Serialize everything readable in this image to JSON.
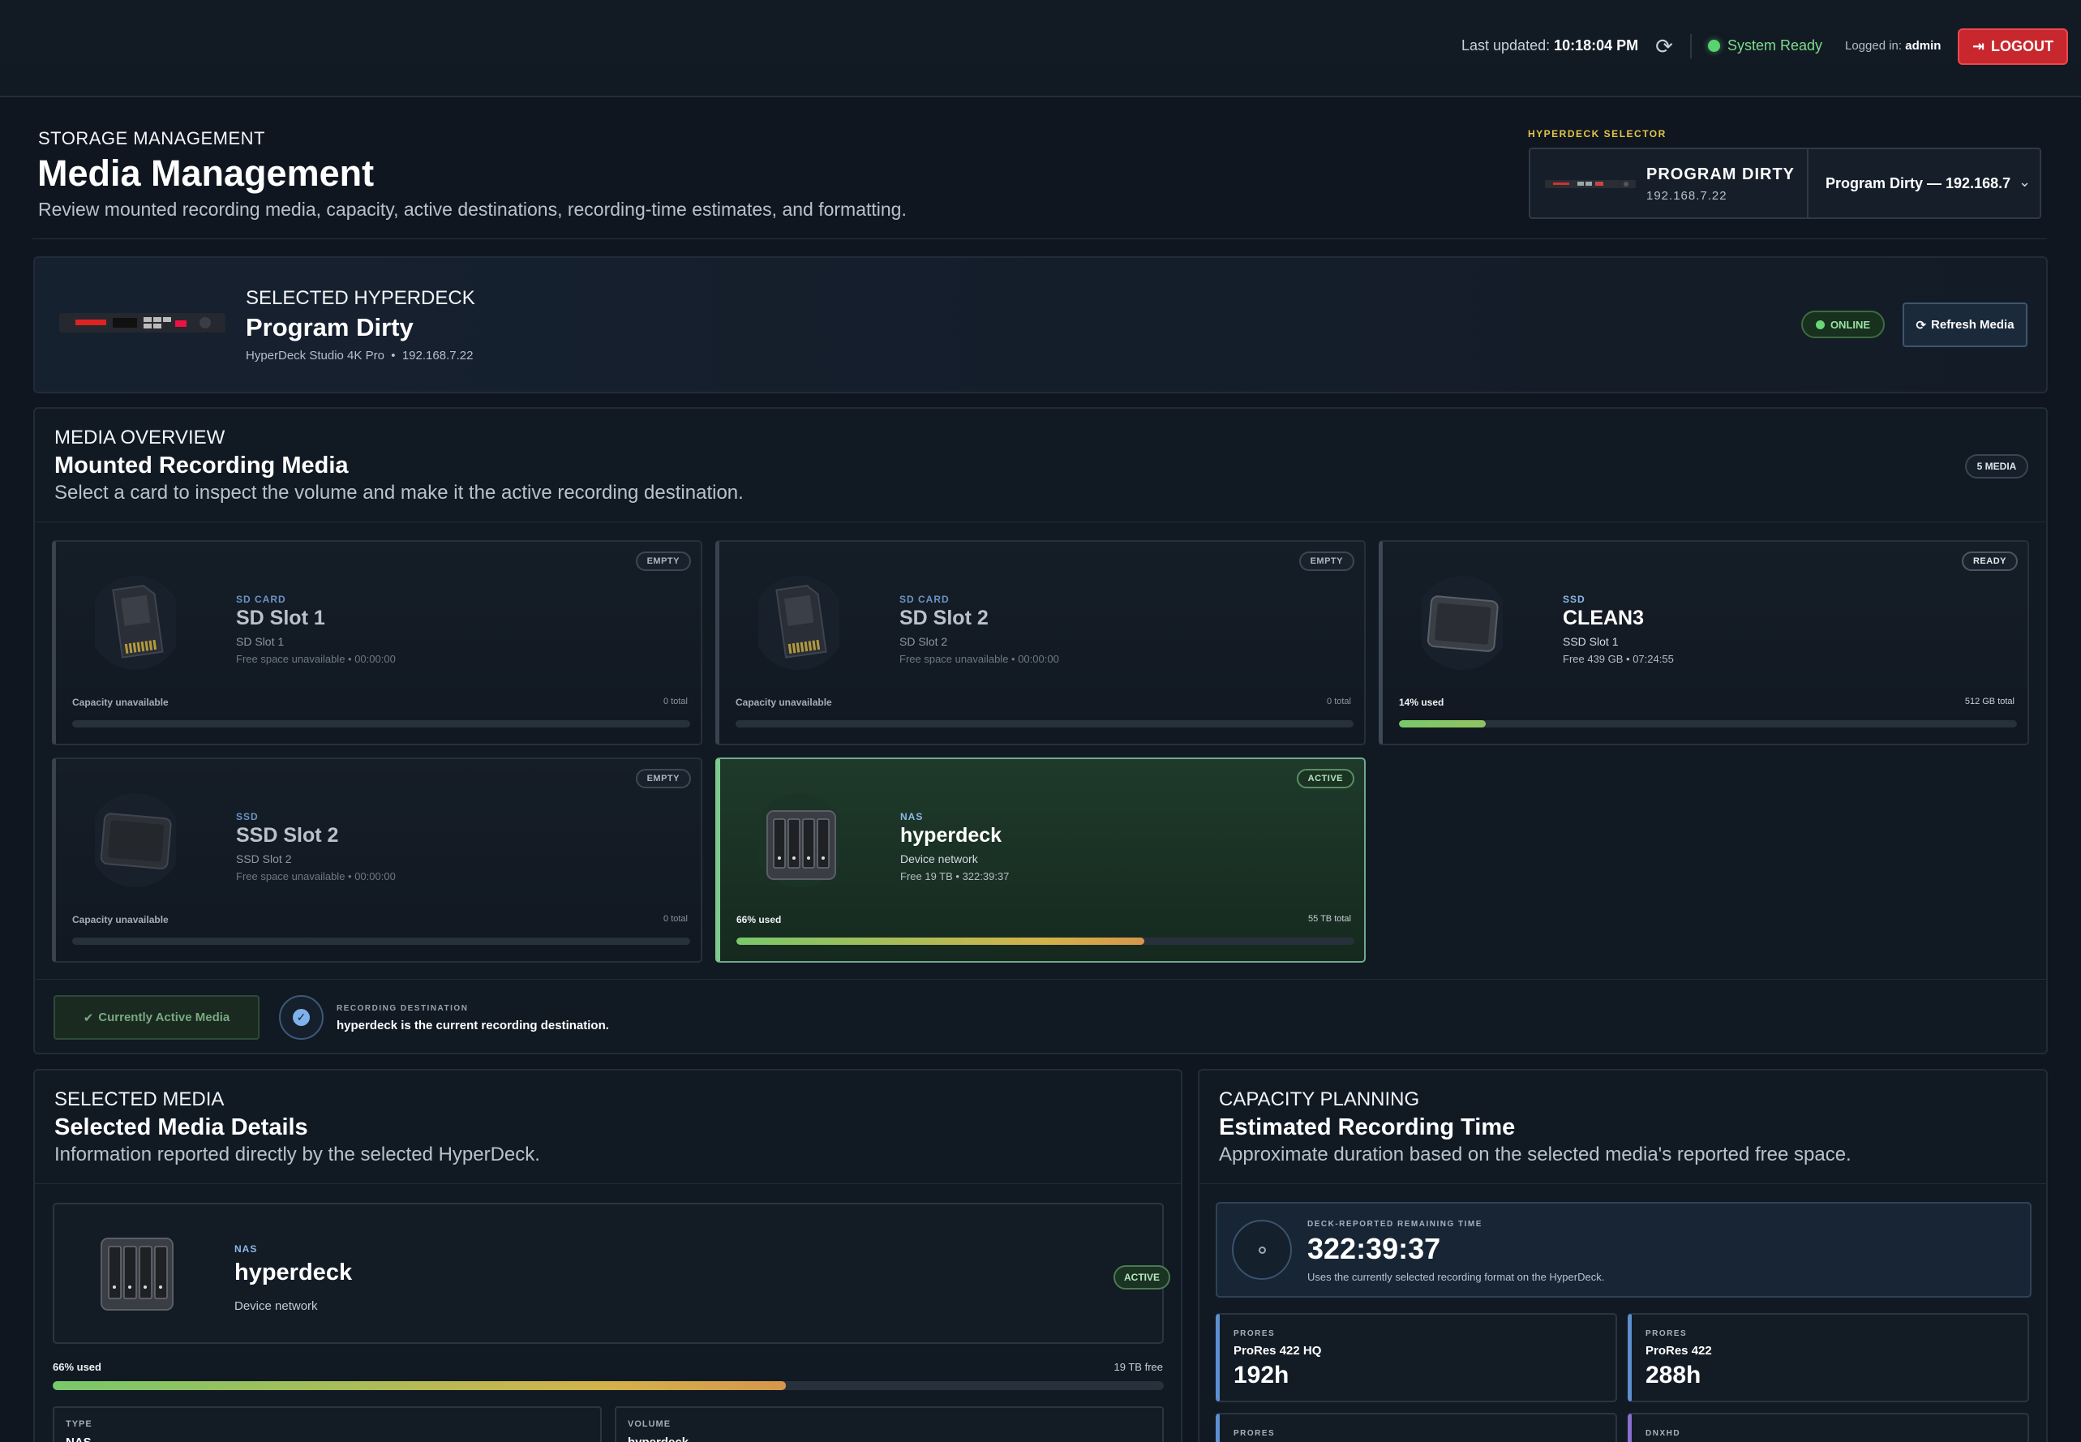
{
  "topbar": {
    "updated_label": "Last updated:",
    "updated_time": "10:18:04 PM",
    "status": "System Ready",
    "logged_label": "Logged in:",
    "user": "admin",
    "logout": "LOGOUT"
  },
  "header": {
    "eyebrow": "STORAGE MANAGEMENT",
    "title": "Media Management",
    "subtitle": "Review mounted recording media, capacity, active destinations, recording-time estimates, and formatting."
  },
  "selector": {
    "label": "HYPERDECK SELECTOR",
    "name": "PROGRAM DIRTY",
    "ip": "192.168.7.22",
    "selected_option": "Program Dirty — 192.168.7"
  },
  "hyperdeck": {
    "eyebrow": "SELECTED HYPERDECK",
    "name": "Program Dirty",
    "model": "HyperDeck Studio 4K Pro",
    "ip": "192.168.7.22",
    "status": "ONLINE",
    "refresh": "Refresh Media"
  },
  "media": {
    "eyebrow": "MEDIA OVERVIEW",
    "title": "Mounted Recording Media",
    "subtitle": "Select a card to inspect the volume and make it the active recording destination.",
    "count": "5 MEDIA",
    "cards": [
      {
        "badge": "EMPTY",
        "type": "SD CARD",
        "name": "SD Slot 1",
        "slot": "SD Slot 1",
        "free": "Free space unavailable • 00:00:00",
        "used": "Capacity unavailable",
        "total": "0 total",
        "used_fraction": 0
      },
      {
        "badge": "EMPTY",
        "type": "SD CARD",
        "name": "SD Slot 2",
        "slot": "SD Slot 2",
        "free": "Free space unavailable • 00:00:00",
        "used": "Capacity unavailable",
        "total": "0 total",
        "used_fraction": 0
      },
      {
        "badge": "READY",
        "type": "SSD",
        "name": "CLEAN3",
        "slot": "SSD Slot 1",
        "free": "Free 439 GB • 07:24:55",
        "used": "14% used",
        "total": "512 GB total",
        "used_fraction": 0.14
      },
      {
        "badge": "EMPTY",
        "type": "SSD",
        "name": "SSD Slot 2",
        "slot": "SSD Slot 2",
        "free": "Free space unavailable • 00:00:00",
        "used": "Capacity unavailable",
        "total": "0 total",
        "used_fraction": 0
      },
      {
        "badge": "ACTIVE",
        "type": "NAS",
        "name": "hyperdeck",
        "slot": "Device network",
        "free": "Free 19 TB • 322:39:37",
        "used": "66% used",
        "total": "55 TB total",
        "used_fraction": 0.66
      }
    ],
    "active_button": "Currently Active Media",
    "dest_label": "RECORDING DESTINATION",
    "dest_text": "hyperdeck is the current recording destination."
  },
  "details": {
    "eyebrow": "SELECTED MEDIA",
    "title": "Selected Media Details",
    "subtitle": "Information reported directly by the selected HyperDeck.",
    "type": "NAS",
    "name": "hyperdeck",
    "network": "Device network",
    "badge": "ACTIVE",
    "used": "66% used",
    "free": "19 TB free",
    "used_fraction": 0.66,
    "fields": [
      {
        "label": "TYPE",
        "value": "NAS"
      },
      {
        "label": "VOLUME",
        "value": "hyperdeck"
      }
    ]
  },
  "capacity": {
    "eyebrow": "CAPACITY PLANNING",
    "title": "Estimated Recording Time",
    "subtitle": "Approximate duration based on the selected media's reported free space.",
    "main_label": "DECK-REPORTED REMAINING TIME",
    "main_time": "322:39:37",
    "main_note": "Uses the currently selected recording format on the HyperDeck.",
    "formats": [
      {
        "family": "PRORES",
        "name": "ProRes 422 HQ",
        "time": "192h"
      },
      {
        "family": "PRORES",
        "name": "ProRes 422",
        "time": "288h"
      },
      {
        "family": "PRORES",
        "name": "",
        "time": ""
      },
      {
        "family": "DNXHD",
        "name": "",
        "time": ""
      }
    ]
  }
}
